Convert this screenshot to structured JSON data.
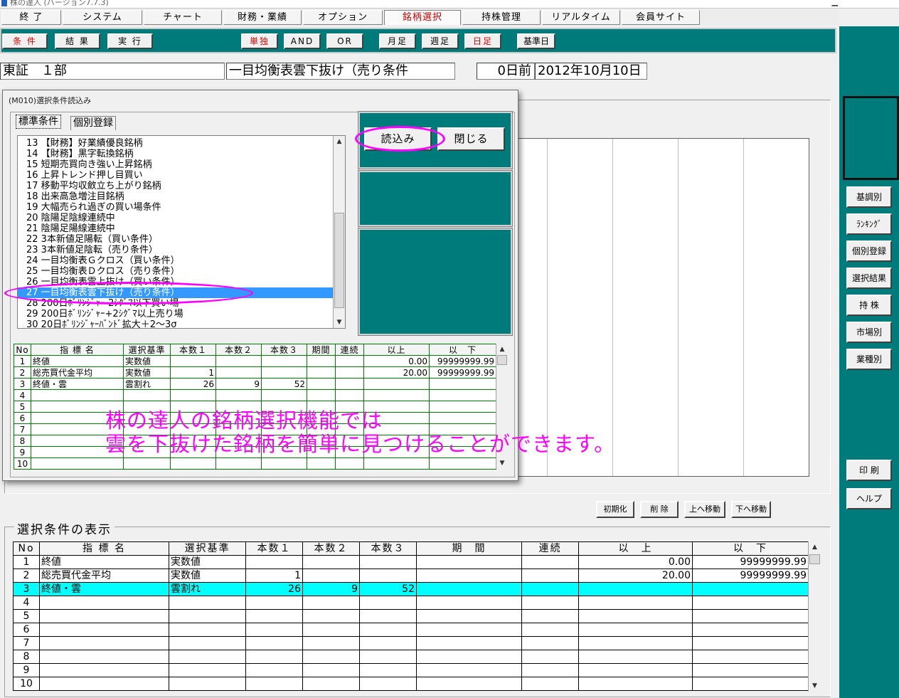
{
  "window": {
    "title": "株の達人 (バージョン7.7.3)"
  },
  "menu": {
    "tabs": [
      {
        "label": "終 了"
      },
      {
        "label": "システム"
      },
      {
        "label": "チャート"
      },
      {
        "label": "財務・業績"
      },
      {
        "label": "オプション"
      },
      {
        "label": "銘柄選択"
      },
      {
        "label": "持株管理"
      },
      {
        "label": "リアルタイム"
      },
      {
        "label": "会員サイト"
      }
    ]
  },
  "toolbar": {
    "condition": "条 件",
    "result": "結 果",
    "execute": "実 行",
    "single": "単独",
    "and": "AND",
    "or": "OR",
    "monthly": "月足",
    "weekly": "週足",
    "daily": "日足",
    "base_date": "基準日"
  },
  "info": {
    "market": "東証　１部",
    "condition_name": "一目均衡表雲下抜け（売り条件",
    "days_before": "0日前",
    "date": "2012年10月10日"
  },
  "right_panel": {
    "buttons": [
      "基調別",
      "ﾗﾝｷﾝｸﾞ",
      "個別登録",
      "選択結果",
      "持 株",
      "市場別",
      "業種別",
      "印 刷",
      "ヘルプ"
    ]
  },
  "dialog": {
    "title": "(M010)選択条件読込み",
    "tabs": [
      "標準条件",
      "個別登録"
    ],
    "load_button": "読込み",
    "close_button": "閉じる",
    "list_items": [
      "13 【財務】好業績優良銘柄",
      "14 【財務】黒字転換銘柄",
      "15 短期売買向き強い上昇銘柄",
      "16 上昇トレンド押し目買い",
      "17 移動平均収斂立ち上がり銘柄",
      "18 出来高急増注目銘柄",
      "19 大幅売られ過ぎの買い場条件",
      "20 陰陽足陰線連続中",
      "21 陰陽足陽線連続中",
      "22 3本新値足陽転（買い条件）",
      "23 3本新値足陰転（売り条件）",
      "24 一目均衡表Ｇクロス（買い条件）",
      "25 一目均衡表Ｄクロス（売り条件）",
      "26 一目均衡表雲上抜け（買い条件）",
      "27 一目均衡表雲下抜け（売り条件）",
      "28 200日ﾎﾞﾘﾝｼﾞｬｰ-2ｼｸﾞﾏ以下買い場",
      "29 200日ﾎﾞﾘﾝｼﾞｬｰ+2ｼｸﾞﾏ以上売り場",
      "30 20日ﾎﾞﾘﾝｼﾞｬｰﾊﾞﾝﾄﾞ拡大＋2～3σ"
    ],
    "selected_index": 14,
    "table": {
      "headers": [
        "No",
        "指 標 名",
        "選択基準",
        "本数１",
        "本数２",
        "本数３",
        "期間",
        "連続",
        "以上",
        "以　下"
      ],
      "rows": [
        [
          "1",
          "終値",
          "実数値",
          "",
          "",
          "",
          "",
          "",
          "0.00",
          "99999999.99"
        ],
        [
          "2",
          "総売買代金平均",
          "実数値",
          "1",
          "",
          "",
          "",
          "",
          "20.00",
          "99999999.99"
        ],
        [
          "3",
          "終値・雲",
          "雲割れ",
          "26",
          "9",
          "52",
          "",
          "",
          "",
          ""
        ],
        [
          "4",
          "",
          "",
          "",
          "",
          "",
          "",
          "",
          "",
          ""
        ],
        [
          "5",
          "",
          "",
          "",
          "",
          "",
          "",
          "",
          "",
          ""
        ],
        [
          "6",
          "",
          "",
          "",
          "",
          "",
          "",
          "",
          "",
          ""
        ],
        [
          "7",
          "",
          "",
          "",
          "",
          "",
          "",
          "",
          "",
          ""
        ],
        [
          "8",
          "",
          "",
          "",
          "",
          "",
          "",
          "",
          "",
          ""
        ],
        [
          "9",
          "",
          "",
          "",
          "",
          "",
          "",
          "",
          "",
          ""
        ],
        [
          "10",
          "",
          "",
          "",
          "",
          "",
          "",
          "",
          "",
          ""
        ]
      ]
    }
  },
  "actions": {
    "init": "初期化",
    "delete": "削 除",
    "move_up": "上へ移動",
    "move_down": "下へ移動"
  },
  "selection": {
    "title": "選択条件の表示",
    "headers": [
      "No",
      "指 標 名",
      "選択基準",
      "本数１",
      "本数２",
      "本数３",
      "期　間",
      "連続",
      "以　上",
      "以　下"
    ],
    "rows": [
      [
        "1",
        "終値",
        "実数値",
        "",
        "",
        "",
        "",
        "",
        "0.00",
        "99999999.99"
      ],
      [
        "2",
        "総売買代金平均",
        "実数値",
        "1",
        "",
        "",
        "",
        "",
        "20.00",
        "99999999.99"
      ],
      [
        "3",
        "終値・雲",
        "雲割れ",
        "26",
        "9",
        "52",
        "",
        "",
        "",
        ""
      ],
      [
        "4",
        "",
        "",
        "",
        "",
        "",
        "",
        "",
        "",
        ""
      ],
      [
        "5",
        "",
        "",
        "",
        "",
        "",
        "",
        "",
        "",
        ""
      ],
      [
        "6",
        "",
        "",
        "",
        "",
        "",
        "",
        "",
        "",
        ""
      ],
      [
        "7",
        "",
        "",
        "",
        "",
        "",
        "",
        "",
        "",
        ""
      ],
      [
        "8",
        "",
        "",
        "",
        "",
        "",
        "",
        "",
        "",
        ""
      ],
      [
        "9",
        "",
        "",
        "",
        "",
        "",
        "",
        "",
        "",
        ""
      ],
      [
        "10",
        "",
        "",
        "",
        "",
        "",
        "",
        "",
        "",
        ""
      ]
    ],
    "highlight_row": 2
  },
  "annotation": {
    "line1": "株の達人の銘柄選択機能では",
    "line2": "雲を下抜けた銘柄を簡単に見つけることができます。",
    "color": "#ff00ff"
  },
  "colors": {
    "teal": "#007b7b",
    "highlight_cyan": "#00ffff",
    "list_selection": "#3399ff",
    "accent_red": "#e00000"
  }
}
